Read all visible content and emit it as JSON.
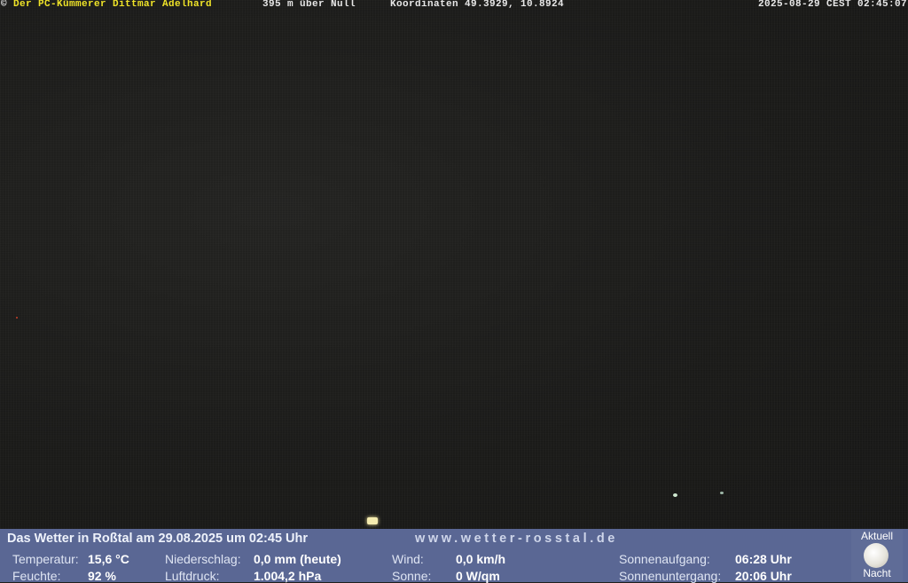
{
  "overlay": {
    "copyright": "©",
    "owner": "Der PC-Kümmerer Dittmar Adelhard",
    "altitude": "395 m über Null",
    "coordinates": "Koordinaten 49.3929, 10.8924",
    "timestamp": "2025-08-29 CEST 02:45:07"
  },
  "weather": {
    "title": "Das Wetter in Roßtal am 29.08.2025 um 02:45 Uhr",
    "site_url": "www.wetter-rosstal.de",
    "temperature": {
      "label": "Temperatur:",
      "value": "15,6 °C"
    },
    "humidity": {
      "label": "Feuchte:",
      "value": "92 %"
    },
    "precipitation": {
      "label": "Niederschlag:",
      "value": "0,0 mm (heute)"
    },
    "pressure": {
      "label": "Luftdruck:",
      "value": "1.004,2 hPa"
    },
    "wind": {
      "label": "Wind:",
      "value": "0,0 km/h"
    },
    "sun": {
      "label": "Sonne:",
      "value": "0 W/qm"
    },
    "sunrise": {
      "label": "Sonnenaufgang:",
      "value": "06:28 Uhr"
    },
    "sunset": {
      "label": "Sonnenuntergang:",
      "value": "20:06 Uhr"
    }
  },
  "moon": {
    "top_label": "Aktuell",
    "bottom_label": "Nacht",
    "icon": "full-moon-icon"
  }
}
